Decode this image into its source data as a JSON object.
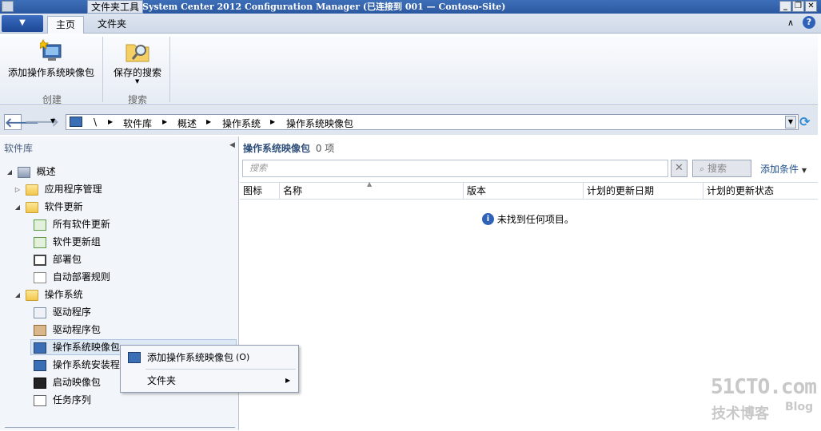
{
  "window": {
    "context_tab": "文件夹工具",
    "title": "System Center 2012 Configuration Manager (已连接到 001 — Contoso-Site)",
    "controls": {
      "minimize": "_",
      "restore": "❐",
      "close": "✕"
    }
  },
  "ribbon_tabs": [
    {
      "label": "主页",
      "active": true
    },
    {
      "label": "文件夹",
      "active": false
    }
  ],
  "ribbon": {
    "groups": [
      {
        "label": "创建",
        "buttons": [
          {
            "label": "添加操作系统映像包",
            "icon": "add-os-image-icon"
          }
        ]
      },
      {
        "label": "搜索",
        "buttons": [
          {
            "label": "保存的搜索",
            "icon": "saved-search-icon"
          }
        ]
      }
    ]
  },
  "address_bar": {
    "breadcrumbs": [
      "\\",
      "软件库",
      "概述",
      "操作系统",
      "操作系统映像包"
    ]
  },
  "left_pane": {
    "title": "软件库",
    "tree": [
      {
        "label": "概述",
        "level": 0,
        "expander": "◢",
        "icon": "overview-icon"
      },
      {
        "label": "应用程序管理",
        "level": 1,
        "expander": "▷",
        "icon": "folder-icon"
      },
      {
        "label": "软件更新",
        "level": 1,
        "expander": "◢",
        "icon": "folder-icon"
      },
      {
        "label": "所有软件更新",
        "level": 2,
        "expander": "",
        "icon": "software-update-icon"
      },
      {
        "label": "软件更新组",
        "level": 2,
        "expander": "",
        "icon": "update-group-icon"
      },
      {
        "label": "部署包",
        "level": 2,
        "expander": "",
        "icon": "deployment-package-icon"
      },
      {
        "label": "自动部署规则",
        "level": 2,
        "expander": "",
        "icon": "deployment-rule-icon"
      },
      {
        "label": "操作系统",
        "level": 1,
        "expander": "◢",
        "icon": "folder-icon"
      },
      {
        "label": "驱动程序",
        "level": 2,
        "expander": "",
        "icon": "driver-icon"
      },
      {
        "label": "驱动程序包",
        "level": 2,
        "expander": "",
        "icon": "driver-package-icon"
      },
      {
        "label": "操作系统映像包",
        "level": 2,
        "expander": "",
        "icon": "os-image-icon",
        "selected": true
      },
      {
        "label": "操作系统安装程序包",
        "level": 2,
        "expander": "",
        "icon": "os-installer-icon"
      },
      {
        "label": "启动映像包",
        "level": 2,
        "expander": "",
        "icon": "boot-image-icon"
      },
      {
        "label": "任务序列",
        "level": 2,
        "expander": "",
        "icon": "task-sequence-icon"
      }
    ]
  },
  "content": {
    "title": "操作系统映像包",
    "count": "0 项",
    "search_placeholder": "搜索",
    "clear_label": "✕",
    "search_button": "搜索",
    "add_criteria": "添加条件",
    "columns": [
      "图标",
      "名称",
      "版本",
      "计划的更新日期",
      "计划的更新状态"
    ],
    "empty_message": "未找到任何项目。"
  },
  "context_menu": {
    "items": [
      {
        "label": "添加操作系统映像包",
        "shortcut": "(O)",
        "icon": "add-os-image-icon",
        "submenu": false
      },
      {
        "label": "文件夹",
        "shortcut": "",
        "icon": "",
        "submenu": true
      }
    ]
  },
  "watermark": {
    "site": "51CTO.com",
    "sub": "技术博客",
    "blog": "Blog"
  },
  "colors": {
    "accent": "#2b58a0",
    "ribbon_bg": "#e6ecf4",
    "pane_bg": "#f2f5f9"
  }
}
